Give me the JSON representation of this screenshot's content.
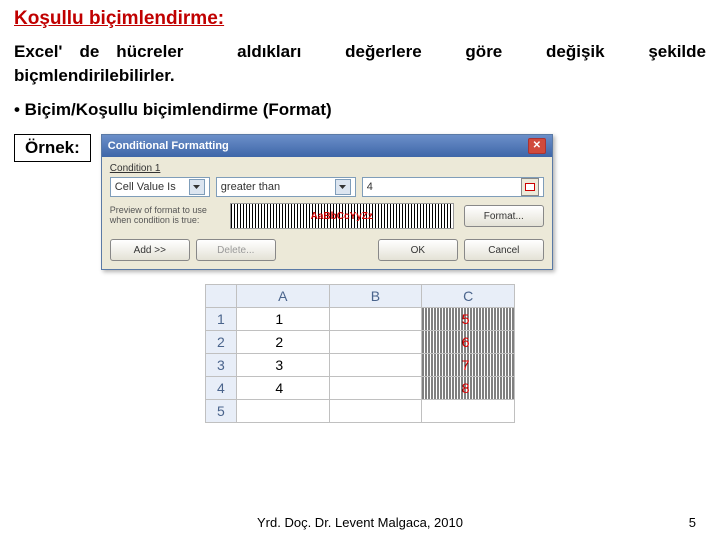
{
  "title": "Koşullu biçimlendirme:",
  "p1": {
    "w1": "Excel' de hücreler",
    "w2": "aldıkları",
    "w3": "değerlere",
    "w4": "göre",
    "w5": "değişik",
    "w6": "şekilde"
  },
  "p1b": "biçmlendirilebilirler.",
  "bullet": "• Biçim/Koşullu biçimlendirme (Format)",
  "ornek": "Örnek:",
  "dialog": {
    "title": "Conditional Formatting",
    "cond_label": "Condition 1",
    "combo1": "Cell Value Is",
    "combo2": "greater than",
    "input_value": "4",
    "preview_label": "Preview of format to use when condition is true:",
    "preview_text": "AaBbCcYyZz",
    "btn_format": "Format...",
    "btn_add": "Add >>",
    "btn_delete": "Delete...",
    "btn_ok": "OK",
    "btn_cancel": "Cancel"
  },
  "sheet": {
    "headers": {
      "a": "A",
      "b": "B",
      "c": "C"
    },
    "rows": [
      {
        "n": "1",
        "a": "1",
        "b": "",
        "c": "5"
      },
      {
        "n": "2",
        "a": "2",
        "b": "",
        "c": "6"
      },
      {
        "n": "3",
        "a": "3",
        "b": "",
        "c": "7"
      },
      {
        "n": "4",
        "a": "4",
        "b": "",
        "c": "8"
      },
      {
        "n": "5",
        "a": "",
        "b": "",
        "c": ""
      }
    ]
  },
  "footer": "Yrd. Doç. Dr. Levent Malgaca, 2010",
  "pagenum": "5"
}
